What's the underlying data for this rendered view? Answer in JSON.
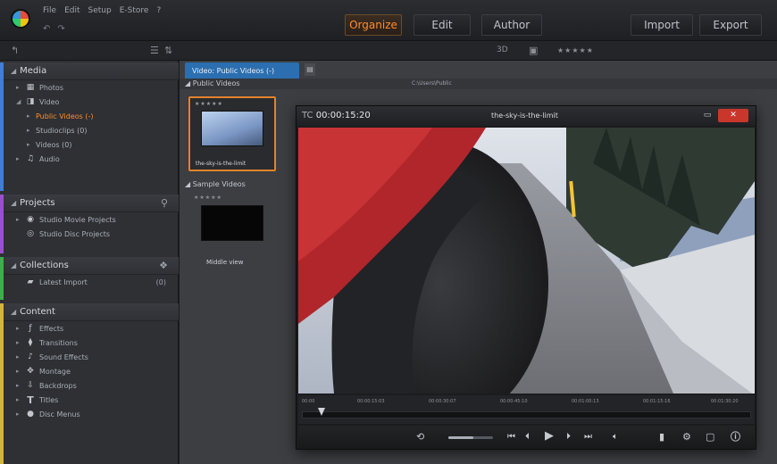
{
  "menu": [
    "File",
    "Edit",
    "Setup",
    "E-Store",
    "?"
  ],
  "modes": {
    "organize": "Organize",
    "edit": "Edit",
    "author": "Author",
    "import": "Import",
    "export": "Export"
  },
  "subbar": {
    "view3d": "3D",
    "rating": "★★★★★"
  },
  "left": {
    "media_title": "Media",
    "media_items": [
      {
        "label": "Photos"
      },
      {
        "label": "Video"
      },
      {
        "label": "Public Videos (-)"
      },
      {
        "label": "Studioclips (0)"
      },
      {
        "label": "Videos (0)"
      },
      {
        "label": "Audio"
      }
    ],
    "projects_title": "Projects",
    "projects_items": [
      {
        "label": "Studio Movie Projects"
      },
      {
        "label": "Studio Disc Projects"
      }
    ],
    "collections_title": "Collections",
    "collections_items": [
      {
        "label": "Latest Import",
        "count": "(0)"
      }
    ],
    "content_title": "Content",
    "content_items": [
      {
        "label": "Effects"
      },
      {
        "label": "Transitions"
      },
      {
        "label": "Sound Effects"
      },
      {
        "label": "Montage"
      },
      {
        "label": "Backdrops"
      },
      {
        "label": "Titles"
      },
      {
        "label": "Disc Menus"
      }
    ]
  },
  "library": {
    "tab": "Video: Public Videos (-)",
    "path": "C:\\Users\\Public",
    "group_public": "Public Videos",
    "group_sample": "Sample Videos",
    "clip1": "the-sky-is-the-limit",
    "clip2": "Middle view",
    "stars": "★★★★★"
  },
  "player": {
    "tc_label": "TC",
    "timecode": "00:00:15:20",
    "clip_name": "the-sky-is-the-limit",
    "ticks": [
      "00:00",
      "00:00:15:03",
      "00:00:30:07",
      "00:00:45:10",
      "00:01:00:13",
      "00:01:15:16",
      "00:01:30:20"
    ]
  }
}
